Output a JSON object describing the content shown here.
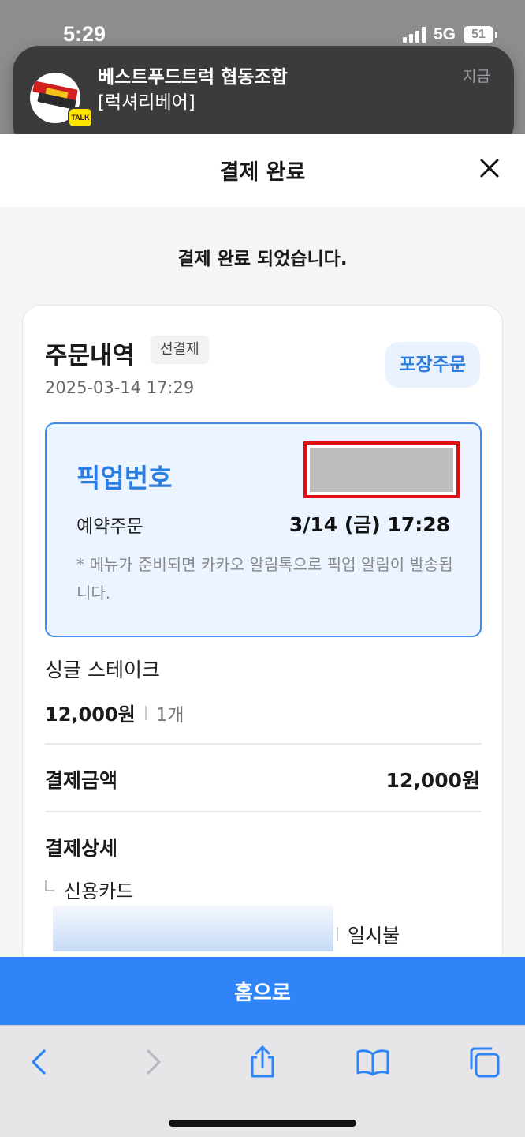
{
  "status_bar": {
    "time": "5:29",
    "network": "5G",
    "battery": "51"
  },
  "notification": {
    "title": "베스트푸드트럭 협동조합",
    "subtitle": "[럭셔리베어]",
    "time": "지금",
    "badge": "TALK"
  },
  "header": {
    "title": "결제 완료"
  },
  "message": "결제 완료 되었습니다.",
  "order": {
    "title": "주문내역",
    "payment_tag": "선결제",
    "datetime": "2025-03-14 17:29",
    "type_badge": "포장주문",
    "pickup": {
      "label": "픽업번호",
      "reserve_label": "예약주문",
      "reserve_time": "3/14 (금) 17:28",
      "note": "* 메뉴가 준비되면 카카오 알림톡으로 픽업 알림이 발송됩니다."
    },
    "item": {
      "name": "싱글 스테이크",
      "price": "12,000원",
      "quantity": "1개"
    },
    "total": {
      "label": "결제금액",
      "value": "12,000원"
    },
    "detail": {
      "title": "결제상세",
      "method": "신용카드",
      "installment": "일시불"
    }
  },
  "home_button": "홈으로",
  "colors": {
    "accent": "#2f85f8",
    "pickup_bg": "#ebf4ff",
    "highlight": "#e11010"
  }
}
